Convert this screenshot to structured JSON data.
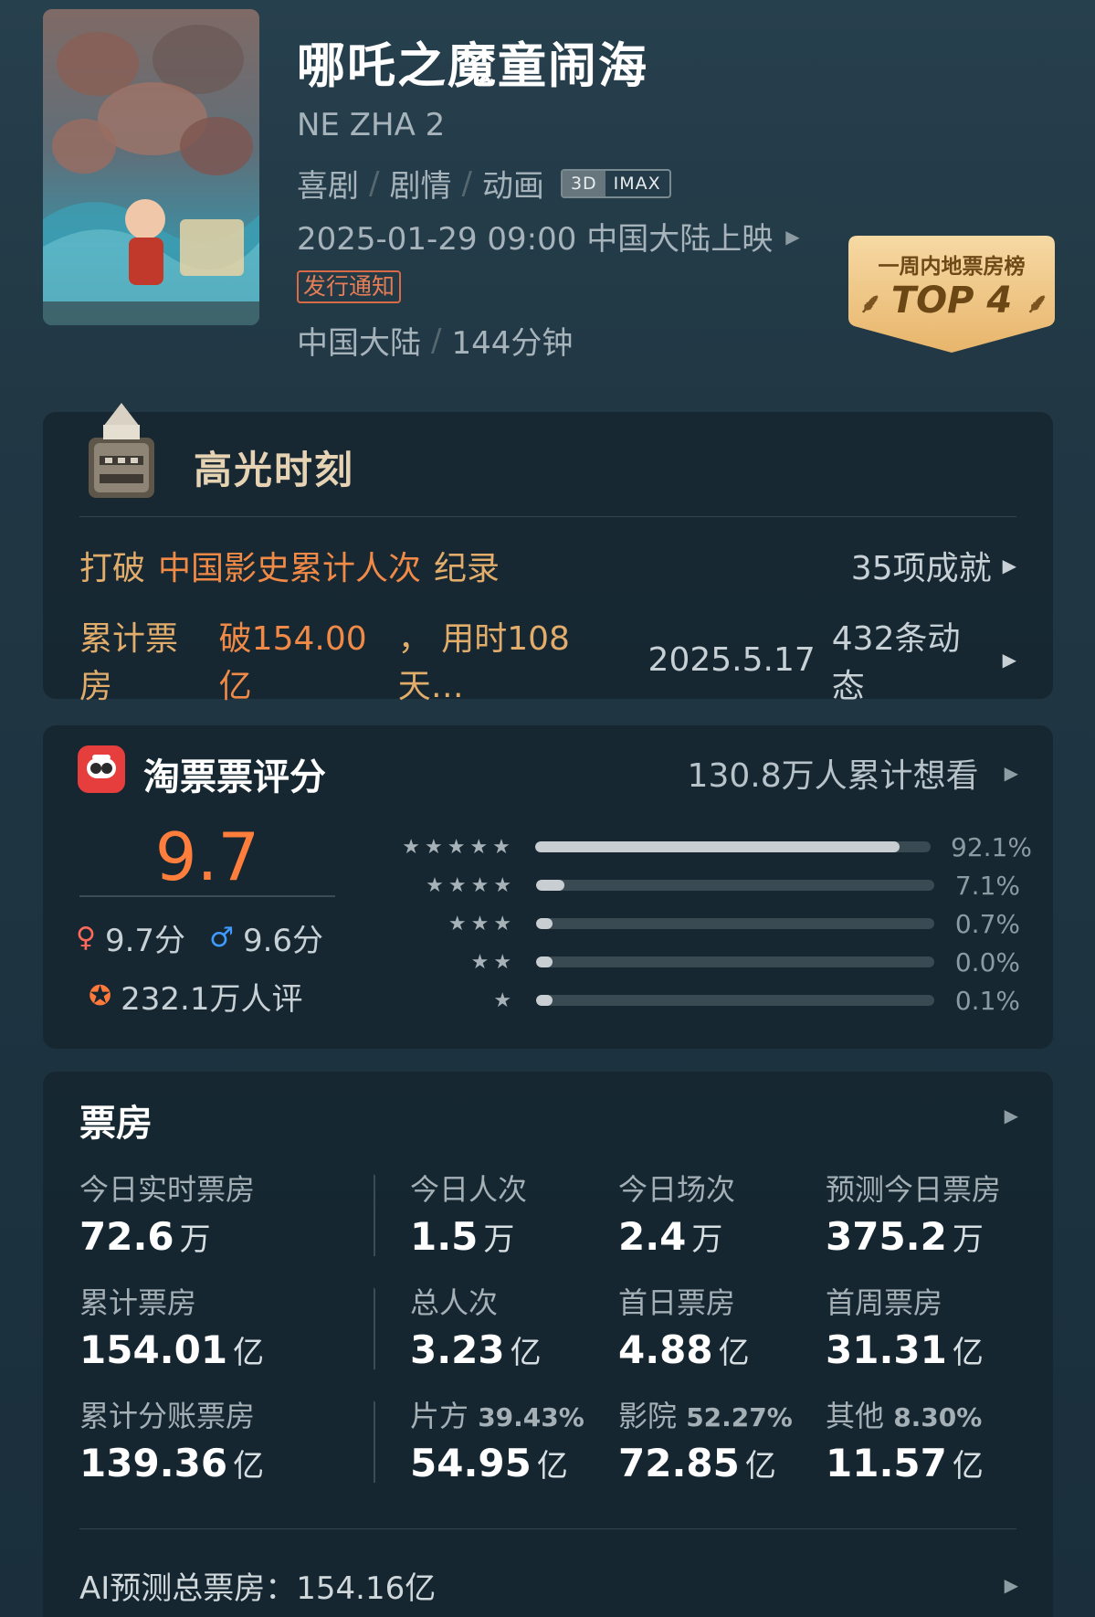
{
  "movie": {
    "title": "哪吒之魔童闹海",
    "english_title": "NE ZHA 2",
    "genres": [
      "喜剧",
      "剧情",
      "动画"
    ],
    "formats": [
      "3D",
      "IMAX"
    ],
    "release": "2025-01-29 09:00 中国大陆上映",
    "notice": "发行通知",
    "region": "中国大陆",
    "duration": "144分钟"
  },
  "top_badge": {
    "title": "一周内地票房榜",
    "rank": "TOP 4"
  },
  "highlights": {
    "title": "高光时刻",
    "row1": {
      "prefix": "打破",
      "emphasis": "中国影史累计人次",
      "suffix": "纪录",
      "right": "35项成就"
    },
    "row2": {
      "prefix": "累计票房",
      "emphasis": "破154.00亿",
      "suffix": "，  用时108天…",
      "date": "2025.5.17",
      "right": "432条动态"
    }
  },
  "rating": {
    "title": "淘票票评分",
    "want": "130.8万人累计想看",
    "score": "9.7",
    "female_score": "9.7分",
    "male_score": "9.6分",
    "count": "232.1万人评",
    "distribution": [
      {
        "stars": "★★★★★",
        "percent": 92.1,
        "label": "92.1%"
      },
      {
        "stars": "★★★★",
        "percent": 7.1,
        "label": "7.1%"
      },
      {
        "stars": "★★★",
        "percent": 0.7,
        "label": "0.7%"
      },
      {
        "stars": "★★",
        "percent": 0.0,
        "label": "0.0%"
      },
      {
        "stars": "★",
        "percent": 0.1,
        "label": "0.1%"
      }
    ]
  },
  "box_office": {
    "title": "票房",
    "rows": [
      [
        {
          "label": "今日实时票房",
          "value": "72.6",
          "unit": "万"
        },
        {
          "label": "今日人次",
          "value": "1.5",
          "unit": "万"
        },
        {
          "label": "今日场次",
          "value": "2.4",
          "unit": "万"
        },
        {
          "label": "预测今日票房",
          "value": "375.2",
          "unit": "万"
        }
      ],
      [
        {
          "label": "累计票房",
          "value": "154.01",
          "unit": "亿"
        },
        {
          "label": "总人次",
          "value": "3.23",
          "unit": "亿"
        },
        {
          "label": "首日票房",
          "value": "4.88",
          "unit": "亿"
        },
        {
          "label": "首周票房",
          "value": "31.31",
          "unit": "亿"
        }
      ],
      [
        {
          "label": "累计分账票房",
          "value": "139.36",
          "unit": "亿"
        },
        {
          "label": "片方",
          "pct": "39.43%",
          "value": "54.95",
          "unit": "亿"
        },
        {
          "label": "影院",
          "pct": "52.27%",
          "value": "72.85",
          "unit": "亿"
        },
        {
          "label": "其他",
          "pct": "8.30%",
          "value": "11.57",
          "unit": "亿"
        }
      ]
    ],
    "ai_prediction": "AI预测总票房：154.16亿"
  },
  "colors": {
    "accent_orange": "#ff7e3c",
    "gold": "#e2ad6b",
    "notice_red": "#d96a48"
  }
}
